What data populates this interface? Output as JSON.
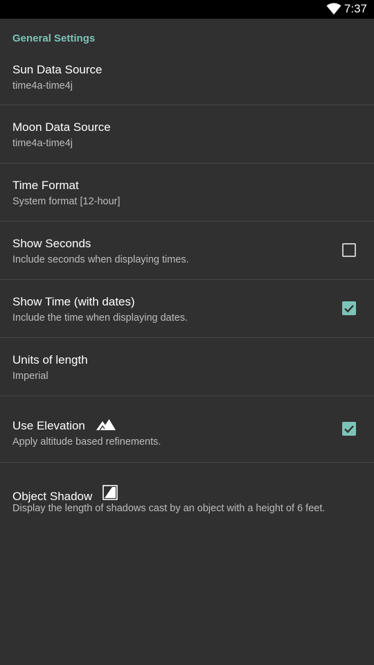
{
  "status_bar": {
    "time": "7:37",
    "icons": [
      "wifi-icon"
    ]
  },
  "colors": {
    "accent": "#7cc4b8",
    "background": "#303030",
    "divider": "#474747"
  },
  "section_header": "General Settings",
  "prefs": [
    {
      "title": "Sun Data Source",
      "summary": "time4a-time4j"
    },
    {
      "title": "Moon Data Source",
      "summary": "time4a-time4j"
    },
    {
      "title": "Time Format",
      "summary": "System format [12-hour]"
    },
    {
      "title": "Show Seconds",
      "summary": "Include seconds when displaying times.",
      "checked": false
    },
    {
      "title": "Show Time (with dates)",
      "summary": "Include the time when displaying dates.",
      "checked": true
    },
    {
      "title": "Units of length",
      "summary": "Imperial"
    },
    {
      "title": "Use Elevation",
      "summary": "Apply altitude based refinements.",
      "checked": true,
      "icon": "mountain-icon"
    },
    {
      "title": "Object Shadow",
      "summary": "Display the length of shadows cast by an object with a height of 6 feet.",
      "icon": "shadow-icon"
    }
  ]
}
